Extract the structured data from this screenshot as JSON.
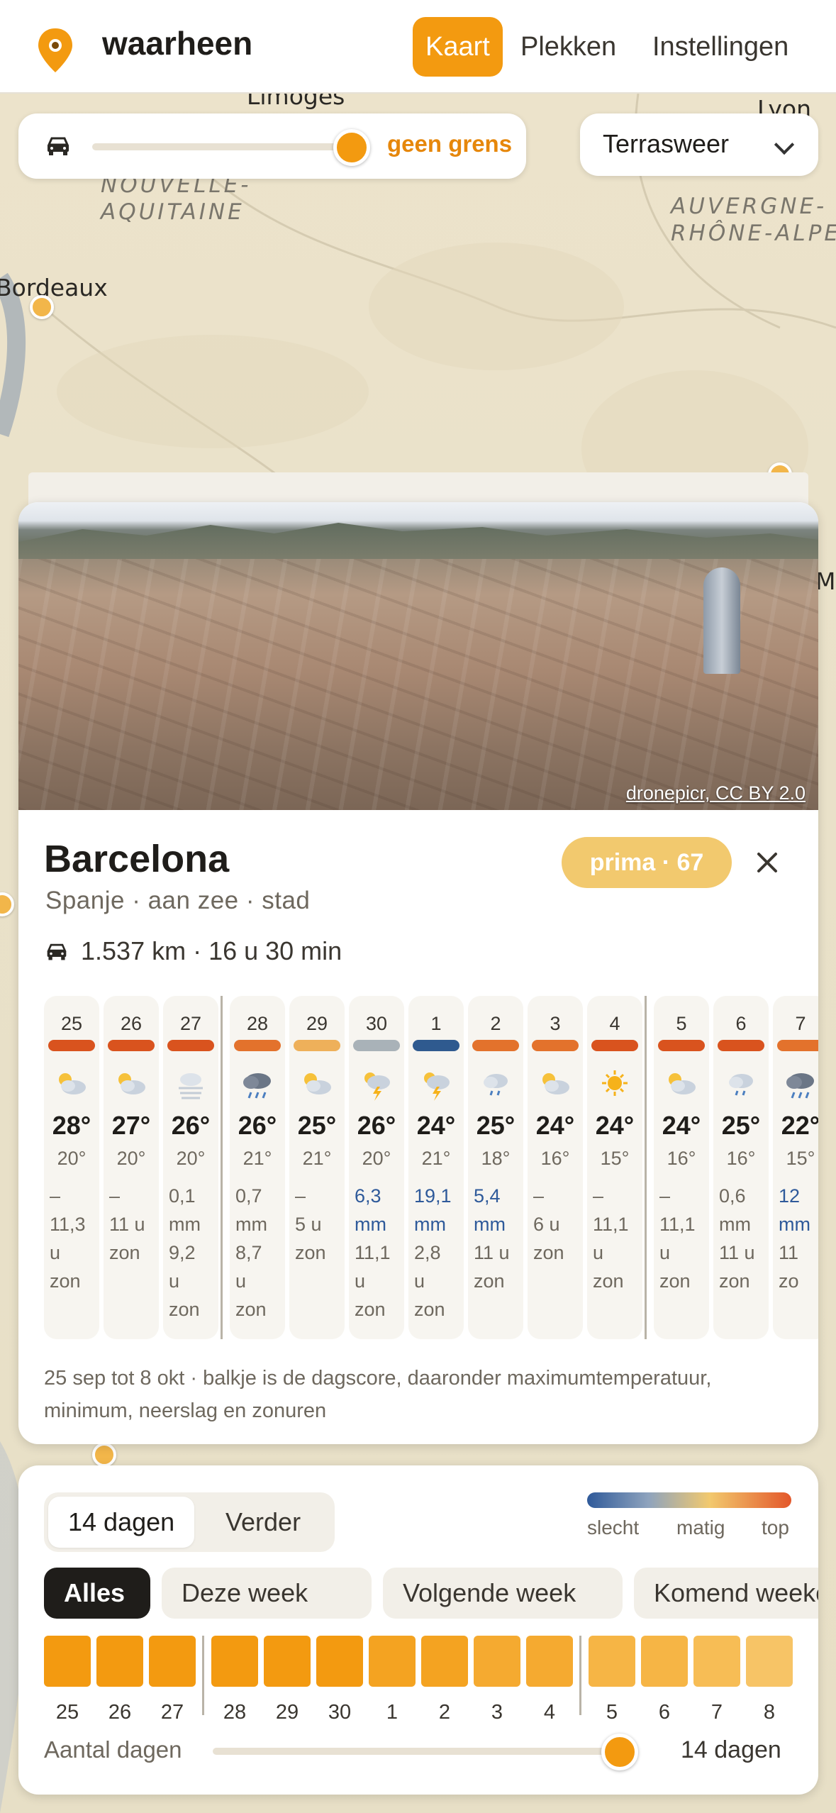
{
  "header": {
    "brand": "waarheen",
    "tabs": [
      {
        "label": "Kaart",
        "active": true
      },
      {
        "label": "Plekken",
        "active": false
      },
      {
        "label": "Instellingen",
        "active": false
      }
    ]
  },
  "map": {
    "labels": {
      "limoges": "Limoges",
      "lyon": "Lyon",
      "nouvelle": "NOUVELLE-\nAQUITAINE",
      "auvergne": "AUVERGNE-\nRHÔNE-ALPE",
      "bordeaux": "Bordeaux",
      "ma": "Ma"
    }
  },
  "travel": {
    "value_label": "geen grens",
    "icon": "car-icon",
    "level": 1.0
  },
  "dropdown": {
    "selected": "Terrasweer"
  },
  "place": {
    "photo_credit": "dronepicr, CC BY 2.0",
    "name": "Barcelona",
    "subtitle": "Spanje · aan zee · stad",
    "score_label": "prima · 67",
    "distance": "1.537 km · 16 u 30 min"
  },
  "forecast": [
    {
      "day": "25",
      "score_color": "#d9531e",
      "icon": "partly-cloudy-icon",
      "max": "28°",
      "min": "20°",
      "rain": [
        "–"
      ],
      "wet": false,
      "sun": [
        "11,3",
        "u",
        "zon"
      ],
      "week": 0
    },
    {
      "day": "26",
      "score_color": "#d9531e",
      "icon": "partly-cloudy-icon",
      "max": "27°",
      "min": "20°",
      "rain": [
        "–"
      ],
      "wet": false,
      "sun": [
        "11 u",
        "zon"
      ],
      "week": 0
    },
    {
      "day": "27",
      "score_color": "#d9531e",
      "icon": "fog-icon",
      "max": "26°",
      "min": "20°",
      "rain": [
        "0,1",
        "mm"
      ],
      "wet": false,
      "sun": [
        "9,2",
        "u",
        "zon"
      ],
      "week": 0
    },
    {
      "day": "28",
      "score_color": "#e3722c",
      "icon": "rain-cloud-icon",
      "max": "26°",
      "min": "21°",
      "rain": [
        "0,7",
        "mm"
      ],
      "wet": false,
      "sun": [
        "8,7",
        "u",
        "zon"
      ],
      "week": 1
    },
    {
      "day": "29",
      "score_color": "#eeb05a",
      "icon": "partly-cloudy-icon",
      "max": "25°",
      "min": "21°",
      "rain": [
        "–"
      ],
      "wet": false,
      "sun": [
        "5 u",
        "zon"
      ],
      "week": 1
    },
    {
      "day": "30",
      "score_color": "#a9b2b8",
      "icon": "thunder-icon",
      "max": "26°",
      "min": "20°",
      "rain": [
        "6,3",
        "mm"
      ],
      "wet": true,
      "sun": [
        "11,1",
        "u",
        "zon"
      ],
      "week": 1
    },
    {
      "day": "1",
      "score_color": "#2f5a8f",
      "icon": "thunder-icon",
      "max": "24°",
      "min": "21°",
      "rain": [
        "19,1",
        "mm"
      ],
      "wet": true,
      "sun": [
        "2,8",
        "u",
        "zon"
      ],
      "week": 1
    },
    {
      "day": "2",
      "score_color": "#e3722c",
      "icon": "drizzle-icon",
      "max": "25°",
      "min": "18°",
      "rain": [
        "5,4",
        "mm"
      ],
      "wet": true,
      "sun": [
        "11 u",
        "zon"
      ],
      "week": 1
    },
    {
      "day": "3",
      "score_color": "#e3722c",
      "icon": "partly-cloudy-icon",
      "max": "24°",
      "min": "16°",
      "rain": [
        "–"
      ],
      "wet": false,
      "sun": [
        "6 u",
        "zon"
      ],
      "week": 1
    },
    {
      "day": "4",
      "score_color": "#d9531e",
      "icon": "sun-icon",
      "max": "24°",
      "min": "15°",
      "rain": [
        "–"
      ],
      "wet": false,
      "sun": [
        "11,1",
        "u",
        "zon"
      ],
      "week": 1
    },
    {
      "day": "5",
      "score_color": "#d9531e",
      "icon": "partly-cloudy-icon",
      "max": "24°",
      "min": "16°",
      "rain": [
        "–"
      ],
      "wet": false,
      "sun": [
        "11,1",
        "u",
        "zon"
      ],
      "week": 2
    },
    {
      "day": "6",
      "score_color": "#d9531e",
      "icon": "drizzle-icon",
      "max": "25°",
      "min": "16°",
      "rain": [
        "0,6",
        "mm"
      ],
      "wet": false,
      "sun": [
        "11 u",
        "zon"
      ],
      "week": 2
    },
    {
      "day": "7",
      "score_color": "#e3722c",
      "icon": "rain-cloud-icon",
      "max": "22°",
      "min": "15°",
      "rain": [
        "12",
        "mm"
      ],
      "wet": true,
      "sun": [
        "11",
        "zo"
      ],
      "week": 2
    }
  ],
  "forecast_caption": "25 sep tot 8 okt · balkje is de dagscore, daaronder maximumtemperatuur, minimum, neerslag en zonuren",
  "panel": {
    "segment": [
      {
        "label": "14 dagen",
        "selected": true
      },
      {
        "label": "Verder",
        "selected": false
      }
    ],
    "legend": {
      "left": "slecht",
      "mid": "matig",
      "right": "top"
    },
    "filters": [
      {
        "label": "Alles",
        "selected": true
      },
      {
        "label": "Deze week",
        "selected": false
      },
      {
        "label": "Volgende week",
        "selected": false
      },
      {
        "label": "Komend weekend",
        "selected": false
      }
    ],
    "mini_days": [
      {
        "label": "25",
        "color": "#f39a10",
        "week": 0
      },
      {
        "label": "26",
        "color": "#f39a10",
        "week": 0
      },
      {
        "label": "27",
        "color": "#f39a10",
        "week": 0
      },
      {
        "label": "28",
        "color": "#f39a10",
        "week": 1
      },
      {
        "label": "29",
        "color": "#f39a10",
        "week": 1
      },
      {
        "label": "30",
        "color": "#f39a10",
        "week": 1
      },
      {
        "label": "1",
        "color": "#f4a321",
        "week": 1
      },
      {
        "label": "2",
        "color": "#f4a321",
        "week": 1
      },
      {
        "label": "3",
        "color": "#f5aa30",
        "week": 1
      },
      {
        "label": "4",
        "color": "#f5aa30",
        "week": 1
      },
      {
        "label": "5",
        "color": "#f6b545",
        "week": 2
      },
      {
        "label": "6",
        "color": "#f6b545",
        "week": 2
      },
      {
        "label": "7",
        "color": "#f7bd55",
        "week": 2
      },
      {
        "label": "8",
        "color": "#f7c466",
        "week": 2
      }
    ],
    "count_label": "Aantal dagen",
    "count_value": "14 dagen",
    "count_level": 1.0
  }
}
